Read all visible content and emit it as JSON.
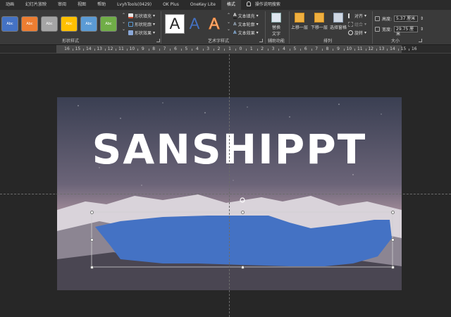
{
  "tabs": [
    {
      "label": "动画"
    },
    {
      "label": "幻灯片放映"
    },
    {
      "label": "审阅"
    },
    {
      "label": "视图"
    },
    {
      "label": "帮助"
    },
    {
      "label": "LvyhTools(0429)"
    },
    {
      "label": "OK Plus"
    },
    {
      "label": "OneKey Lite"
    },
    {
      "label": "格式"
    },
    {
      "label": "操作说明搜索"
    }
  ],
  "ribbon": {
    "shape_styles": {
      "label": "形状样式",
      "presets": [
        {
          "text": "Abc",
          "color": "#4472c4"
        },
        {
          "text": "Abc",
          "color": "#ed7d31"
        },
        {
          "text": "Abc",
          "color": "#a5a5a5"
        },
        {
          "text": "Abc",
          "color": "#ffc000"
        },
        {
          "text": "Abc",
          "color": "#5b9bd5"
        },
        {
          "text": "Abc",
          "color": "#70ad47"
        }
      ],
      "fill": "形状填充",
      "outline": "形状轮廓",
      "effects": "形状效果"
    },
    "wordart_styles": {
      "label": "艺术字样式",
      "letter": "A",
      "text_fill": "文本填充",
      "text_outline": "文本轮廓",
      "text_effects": "文本效果"
    },
    "accessibility": {
      "label": "辅助功能",
      "alt_text_line1": "替换",
      "alt_text_line2": "文字"
    },
    "arrange": {
      "label": "排列",
      "bring_forward": "上移一层",
      "send_backward": "下移一层",
      "selection_pane": "选择窗格",
      "align": "对齐",
      "group": "组合",
      "rotate": "旋转"
    },
    "size": {
      "label": "大小",
      "height_label": "高度:",
      "height_value": "5.37 厘米",
      "width_label": "宽度:",
      "width_value": "29.75 厘米"
    }
  },
  "ruler": {
    "numbers": [
      "16",
      "15",
      "14",
      "13",
      "12",
      "11",
      "10",
      "9",
      "8",
      "7",
      "6",
      "5",
      "4",
      "3",
      "2",
      "1",
      "0",
      "1",
      "2",
      "3",
      "4",
      "5",
      "6",
      "7",
      "8",
      "9",
      "10",
      "11",
      "12",
      "13",
      "14",
      "15",
      "16"
    ]
  },
  "slide": {
    "title": "SANSHIPPT",
    "shape_color": "#4472c4"
  },
  "colors": {
    "accent": "#4472c4",
    "ribbon_bg": "#3a3a3a",
    "canvas_bg": "#272727"
  }
}
